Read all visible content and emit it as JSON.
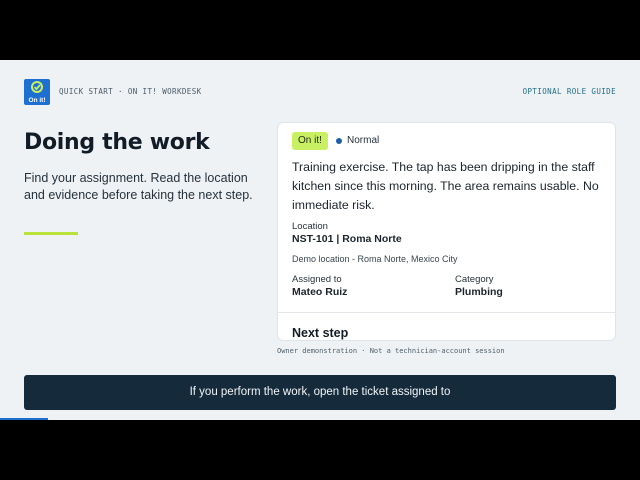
{
  "brand": {
    "logo_text": "On it!",
    "color": "#1d6fd1"
  },
  "header": {
    "kicker": "QUICK START · ON IT! WORKDESK",
    "role_guide_link": "OPTIONAL ROLE GUIDE"
  },
  "intro": {
    "title": "Doing the work",
    "lede": "Find your assignment. Read the location and evidence before taking the next step.",
    "accent_color": "#b9e33a"
  },
  "ticket": {
    "status": "On it!",
    "priority": "Normal",
    "description": "Training exercise. The tap has been dripping in the staff kitchen since this morning. The area remains usable. No immediate risk.",
    "location_label": "Location",
    "location_value": "NST-101 | Roma Norte",
    "location_detail": "Demo location - Roma Norte, Mexico City",
    "assigned_label": "Assigned to",
    "assigned_value": "Mateo Ruiz",
    "category_label": "Category",
    "category_value": "Plumbing",
    "next_step_label": "Next step"
  },
  "footnote": "Owner demonstration · Not a technician-account session",
  "caption": "If you perform the work, open the ticket assigned to",
  "playback": {
    "progress_fraction": 0.075
  }
}
